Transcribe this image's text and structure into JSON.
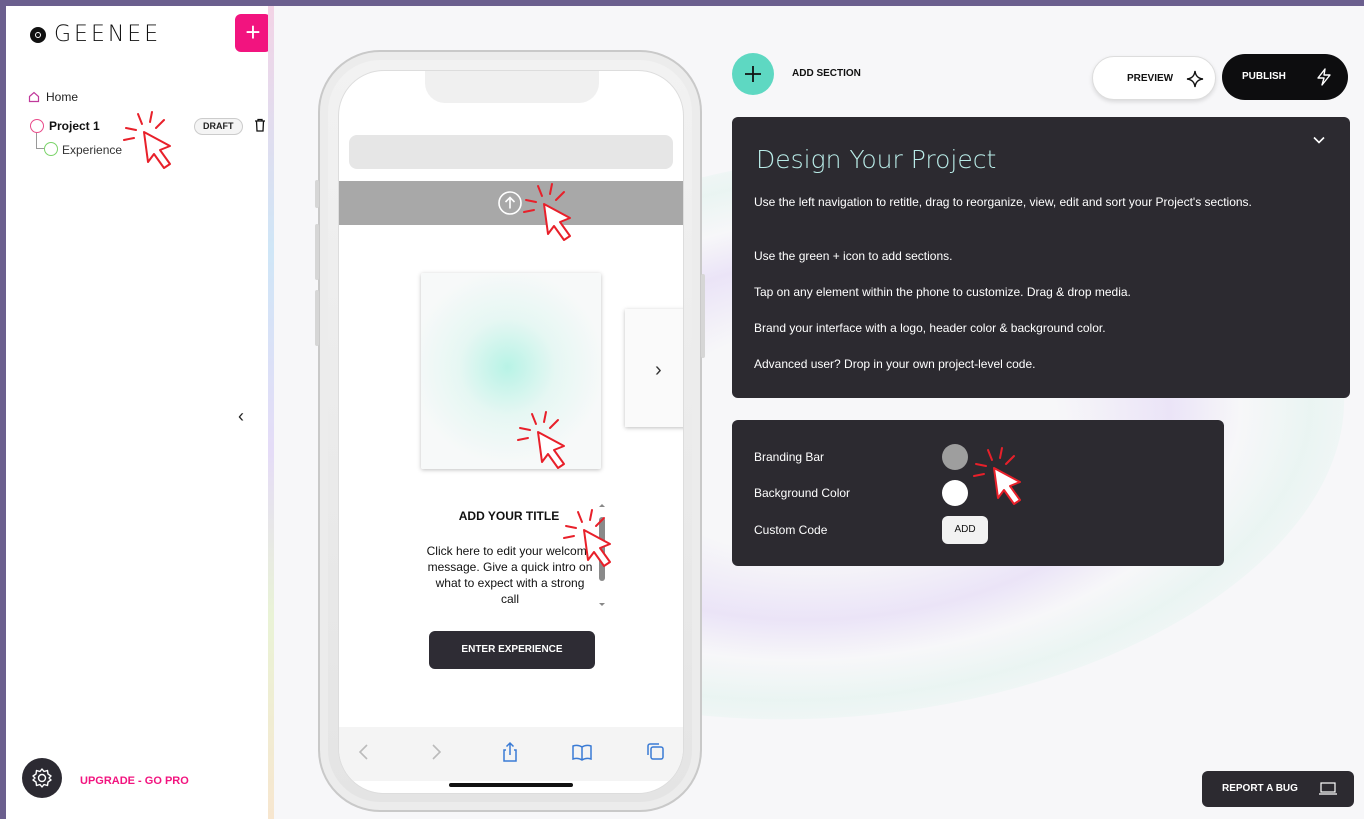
{
  "app": {
    "logo_text": "GEENEE",
    "add_project_label": "+"
  },
  "sidebar": {
    "home_label": "Home",
    "project": {
      "label": "Project 1",
      "status": "DRAFT"
    },
    "experience_label": "Experience",
    "collapse_icon": "‹",
    "upgrade_label": "UPGRADE - GO PRO"
  },
  "phone": {
    "card_next_icon": "›",
    "welcome_title": "ADD YOUR TITLE",
    "welcome_message": "Click here to edit your welcome message. Give a quick intro on what to expect with a strong call",
    "enter_label": "ENTER EXPERIENCE"
  },
  "toolbar": {
    "add_section_label": "ADD SECTION",
    "preview_label": "PREVIEW",
    "publish_label": "PUBLISH"
  },
  "info": {
    "title": "Design Your Project",
    "lines": [
      "Use the left navigation to retitle, drag to reorganize, view, edit and sort your Project's sections.",
      "Use the green + icon to add sections.",
      "Tap on any element within the phone to customize. Drag & drop media.",
      "Brand your interface with a logo, header color & background color.",
      "Advanced user? Drop in your own project-level code."
    ]
  },
  "settings": {
    "branding_label": "Branding Bar",
    "background_label": "Background Color",
    "custom_code_label": "Custom Code",
    "add_label": "ADD",
    "branding_color": "#9e9e9e",
    "background_color": "#ffffff"
  },
  "footer": {
    "report_bug_label": "REPORT A BUG"
  },
  "colors": {
    "accent_pink": "#f2147f",
    "accent_green": "#5ed8c2",
    "card_dark": "#2c2a30"
  }
}
